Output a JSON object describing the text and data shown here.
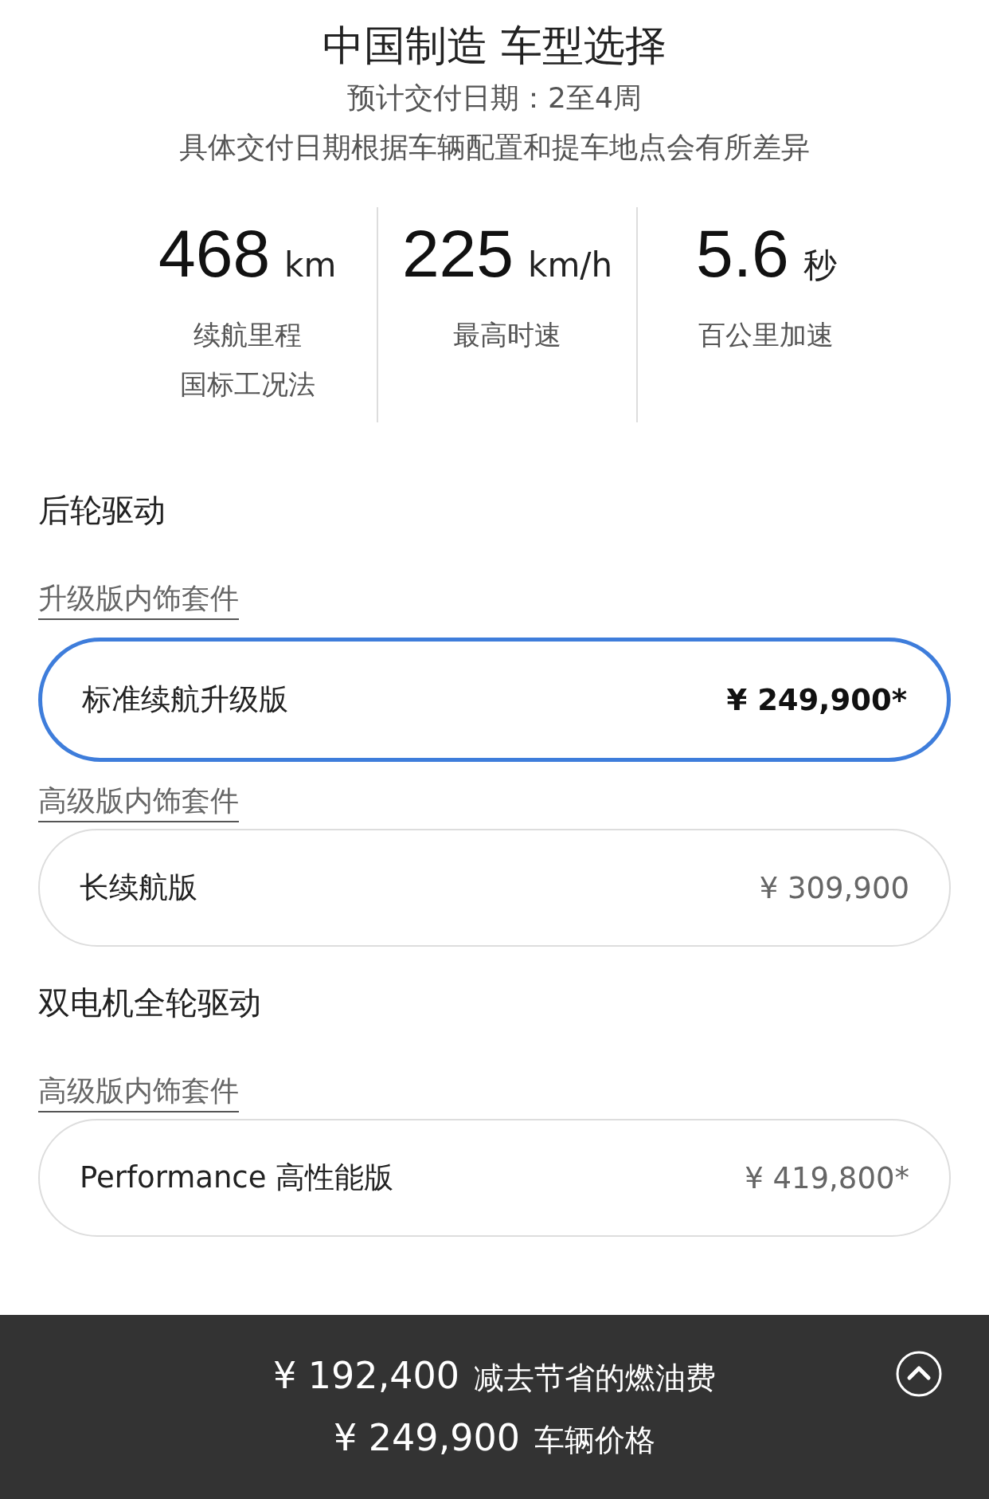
{
  "title": "中国制造 车型选择",
  "delivery": [
    "预计交付日期：2至4周",
    "具体交付日期根据车辆配置和提车地点会有所差异"
  ],
  "stats": [
    {
      "value": "468",
      "unit": "km",
      "labels": [
        "续航里程",
        "国标工况法"
      ]
    },
    {
      "value": "225",
      "unit": "km/h",
      "labels": [
        "最高时速"
      ]
    },
    {
      "value": "5.6",
      "unit": "秒",
      "labels": [
        "百公里加速"
      ]
    }
  ],
  "groups": [
    {
      "heading": "后轮驱动",
      "packages": [
        {
          "link": "升级版内饰套件",
          "options": [
            {
              "name": "标准续航升级版",
              "price": "¥ 249,900*",
              "selected": true
            }
          ]
        },
        {
          "link": "高级版内饰套件",
          "options": [
            {
              "name": "长续航版",
              "price": "¥ 309,900",
              "selected": false
            }
          ]
        }
      ]
    },
    {
      "heading": "双电机全轮驱动",
      "packages": [
        {
          "link": "高级版内饰套件",
          "options": [
            {
              "name": "Performance 高性能版",
              "price": "¥ 419,800*",
              "selected": false
            }
          ]
        }
      ]
    }
  ],
  "summary": {
    "lines": [
      {
        "amount": "¥ 192,400",
        "label": "减去节省的燃油费"
      },
      {
        "amount": "¥ 249,900",
        "label": "车辆价格"
      }
    ]
  }
}
